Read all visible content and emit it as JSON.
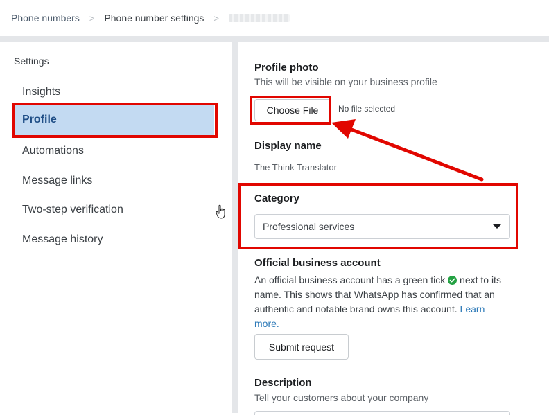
{
  "breadcrumb": {
    "link": "Phone numbers",
    "current": "Phone number settings",
    "separator": ">"
  },
  "sidebar": {
    "title": "Settings",
    "items": [
      {
        "label": "Insights"
      },
      {
        "label": "Profile",
        "active": true
      },
      {
        "label": "Automations"
      },
      {
        "label": "Message links"
      },
      {
        "label": "Two-step verification"
      },
      {
        "label": "Message history"
      }
    ]
  },
  "profile_photo": {
    "title": "Profile photo",
    "subtitle": "This will be visible on your business profile",
    "choose_button": "Choose File",
    "file_status": "No file selected"
  },
  "display_name": {
    "title": "Display name",
    "value": "The Think Translator"
  },
  "category": {
    "title": "Category",
    "selected": "Professional services"
  },
  "official_account": {
    "title": "Official business account",
    "text_before_tick": "An official business account has a green tick",
    "text_after_tick": "next to its name. This shows that WhatsApp has confirmed that an authentic and notable brand owns this account.",
    "learn_more": "Learn more.",
    "button": "Submit request"
  },
  "description": {
    "title": "Description",
    "subtitle": "Tell your customers about your company"
  },
  "colors": {
    "highlight_red": "#e10600",
    "active_nav_bg": "#c3daf2",
    "link_blue": "#2d7ab8",
    "tick_green": "#25a244"
  }
}
